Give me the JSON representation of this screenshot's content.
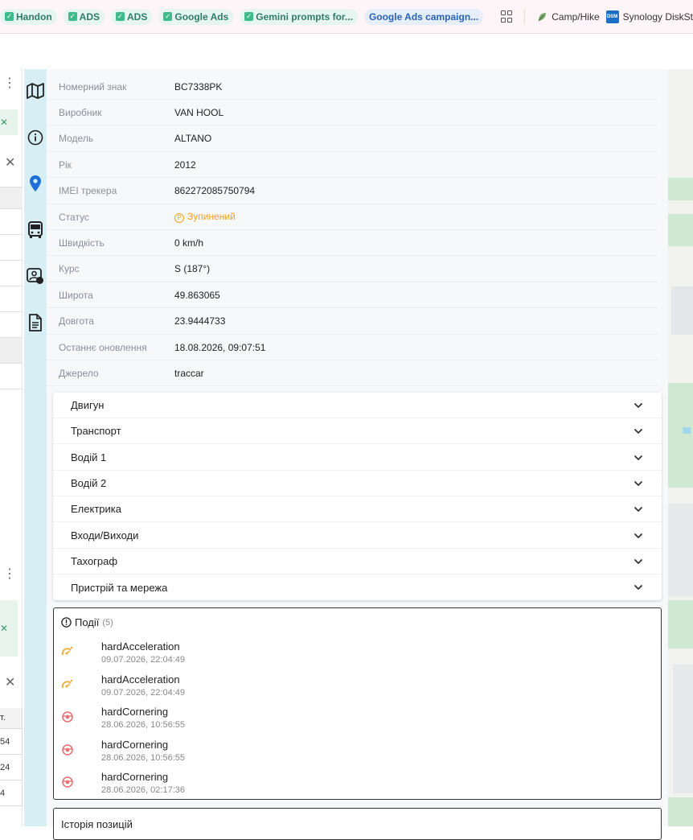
{
  "bookmarks": [
    {
      "label": "Handon",
      "style": "green"
    },
    {
      "label": "ADS",
      "style": "green"
    },
    {
      "label": "ADS",
      "style": "green"
    },
    {
      "label": "Google Ads",
      "style": "green"
    },
    {
      "label": "Gemini prompts for...",
      "style": "green"
    },
    {
      "label": "Google Ads campaign...",
      "style": "blue"
    }
  ],
  "bookmark_links": [
    {
      "label": "Camp/Hike"
    },
    {
      "label": "Synology DiskSt"
    }
  ],
  "syno_badge": "DSM",
  "left_pane": {
    "cells": [
      "т.",
      "54",
      "24",
      "4"
    ]
  },
  "vehicle": {
    "attributes": [
      {
        "label": "Номерний знак",
        "value": "BC7338PK"
      },
      {
        "label": "Виробник",
        "value": "VAN HOOL"
      },
      {
        "label": "Модель",
        "value": "ALTANO"
      },
      {
        "label": "Рік",
        "value": "2012"
      },
      {
        "label": "IMEI трекера",
        "value": "862272085750794"
      },
      {
        "label": "Статус",
        "value": "Зупинений"
      },
      {
        "label": "Швидкість",
        "value": "0 km/h"
      },
      {
        "label": "Курс",
        "value": "S (187°)"
      },
      {
        "label": "Широта",
        "value": "49.863065"
      },
      {
        "label": "Довгота",
        "value": "23.9444733"
      },
      {
        "label": "Останнє оновлення",
        "value": "18.08.2026, 09:07:51"
      },
      {
        "label": "Джерело",
        "value": "traccar"
      }
    ],
    "status_icon": "P"
  },
  "accordion": [
    {
      "label": "Двигун"
    },
    {
      "label": "Транспорт"
    },
    {
      "label": "Водій 1"
    },
    {
      "label": "Водій 2"
    },
    {
      "label": "Електрика"
    },
    {
      "label": "Входи/Виходи"
    },
    {
      "label": "Тахограф"
    },
    {
      "label": "Пристрій та мережа"
    }
  ],
  "events": {
    "title": "Події",
    "count": "(5)",
    "items": [
      {
        "name": "hardAcceleration",
        "time": "09.07.2026, 22:04:49",
        "icon": "acceleration-icon"
      },
      {
        "name": "hardAcceleration",
        "time": "09.07.2026, 22:04:49",
        "icon": "acceleration-icon"
      },
      {
        "name": "hardCornering",
        "time": "28.06.2026, 10:56:55",
        "icon": "cornering-icon"
      },
      {
        "name": "hardCornering",
        "time": "28.06.2026, 10:56:55",
        "icon": "cornering-icon"
      },
      {
        "name": "hardCornering",
        "time": "28.06.2026, 02:17:36",
        "icon": "cornering-icon"
      }
    ]
  },
  "history": {
    "title": "Історія позицій"
  },
  "colors": {
    "status": "#f0a020",
    "rail": "#d7eef4",
    "accel": "#f0b040",
    "corner": "#e57373"
  }
}
